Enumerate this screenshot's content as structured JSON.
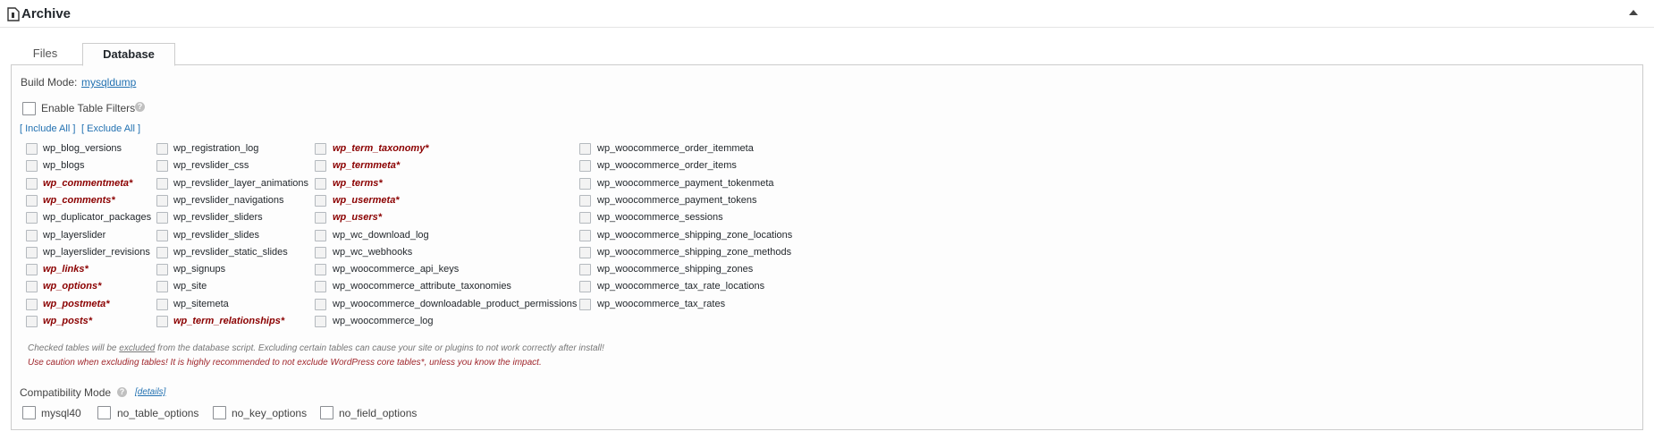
{
  "header": {
    "title": "Archive",
    "icon": "archive-file-icon",
    "toggle_icon": "collapse-arrow-icon"
  },
  "tabs": [
    {
      "label": "Files",
      "active": false
    },
    {
      "label": "Database",
      "active": true
    }
  ],
  "build_mode": {
    "label": "Build Mode:",
    "value": "mysqldump"
  },
  "table_filters": {
    "label": "Enable Table Filters",
    "checked": false
  },
  "bulk": {
    "include_all": "[ Include All ]",
    "exclude_all": "[ Exclude All ]"
  },
  "tables": {
    "col1": [
      {
        "name": "wp_blog_versions",
        "core": false
      },
      {
        "name": "wp_blogs",
        "core": false
      },
      {
        "name": "wp_commentmeta*",
        "core": true
      },
      {
        "name": "wp_comments*",
        "core": true
      },
      {
        "name": "wp_duplicator_packages",
        "core": false
      },
      {
        "name": "wp_layerslider",
        "core": false
      },
      {
        "name": "wp_layerslider_revisions",
        "core": false
      },
      {
        "name": "wp_links*",
        "core": true
      },
      {
        "name": "wp_options*",
        "core": true
      },
      {
        "name": "wp_postmeta*",
        "core": true
      },
      {
        "name": "wp_posts*",
        "core": true
      }
    ],
    "col2": [
      {
        "name": "wp_registration_log",
        "core": false
      },
      {
        "name": "wp_revslider_css",
        "core": false
      },
      {
        "name": "wp_revslider_layer_animations",
        "core": false
      },
      {
        "name": "wp_revslider_navigations",
        "core": false
      },
      {
        "name": "wp_revslider_sliders",
        "core": false
      },
      {
        "name": "wp_revslider_slides",
        "core": false
      },
      {
        "name": "wp_revslider_static_slides",
        "core": false
      },
      {
        "name": "wp_signups",
        "core": false
      },
      {
        "name": "wp_site",
        "core": false
      },
      {
        "name": "wp_sitemeta",
        "core": false
      },
      {
        "name": "wp_term_relationships*",
        "core": true
      }
    ],
    "col3": [
      {
        "name": "wp_term_taxonomy*",
        "core": true
      },
      {
        "name": "wp_termmeta*",
        "core": true
      },
      {
        "name": "wp_terms*",
        "core": true
      },
      {
        "name": "wp_usermeta*",
        "core": true
      },
      {
        "name": "wp_users*",
        "core": true
      },
      {
        "name": "wp_wc_download_log",
        "core": false
      },
      {
        "name": "wp_wc_webhooks",
        "core": false
      },
      {
        "name": "wp_woocommerce_api_keys",
        "core": false
      },
      {
        "name": "wp_woocommerce_attribute_taxonomies",
        "core": false
      },
      {
        "name": "wp_woocommerce_downloadable_product_permissions",
        "core": false
      },
      {
        "name": "wp_woocommerce_log",
        "core": false
      }
    ],
    "col4": [
      {
        "name": "wp_woocommerce_order_itemmeta",
        "core": false
      },
      {
        "name": "wp_woocommerce_order_items",
        "core": false
      },
      {
        "name": "wp_woocommerce_payment_tokenmeta",
        "core": false
      },
      {
        "name": "wp_woocommerce_payment_tokens",
        "core": false
      },
      {
        "name": "wp_woocommerce_sessions",
        "core": false
      },
      {
        "name": "wp_woocommerce_shipping_zone_locations",
        "core": false
      },
      {
        "name": "wp_woocommerce_shipping_zone_methods",
        "core": false
      },
      {
        "name": "wp_woocommerce_shipping_zones",
        "core": false
      },
      {
        "name": "wp_woocommerce_tax_rate_locations",
        "core": false
      },
      {
        "name": "wp_woocommerce_tax_rates",
        "core": false
      }
    ]
  },
  "notes": {
    "line1_before": "Checked tables will be ",
    "line1_emph": "excluded",
    "line1_after": " from the database script. Excluding certain tables can cause your site or plugins to not work correctly after install!",
    "line2": "Use caution when excluding tables! It is highly recommended to not exclude WordPress core tables*, unless you know the impact."
  },
  "compatibility": {
    "label": "Compatibility Mode",
    "details": "[details]",
    "options": [
      {
        "label": "mysql40",
        "checked": false
      },
      {
        "label": "no_table_options",
        "checked": false
      },
      {
        "label": "no_key_options",
        "checked": false
      },
      {
        "label": "no_field_options",
        "checked": false
      }
    ]
  },
  "colors": {
    "core_table": "#8b0000",
    "link": "#2271b1",
    "warning": "#a0262c"
  }
}
